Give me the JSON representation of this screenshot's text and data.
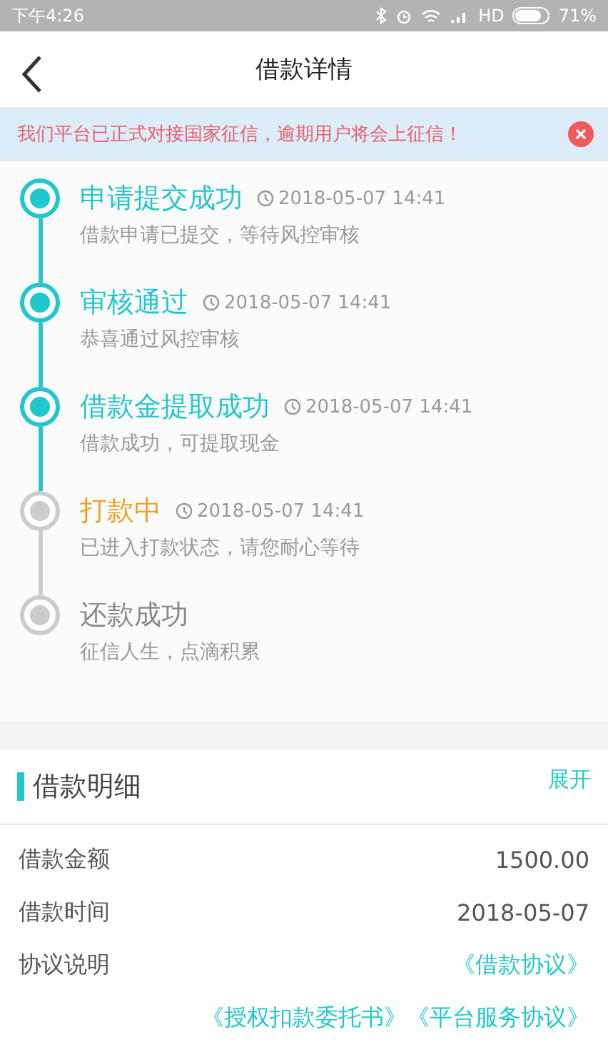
{
  "status_bar": {
    "time": "下午4:26",
    "network": "HD",
    "battery": "71%"
  },
  "header": {
    "title": "借款详情"
  },
  "notice": {
    "text": "我们平台已正式对接国家征信，逾期用户将会上征信！"
  },
  "steps": [
    {
      "title": "申请提交成功",
      "time": "2018-05-07 14:41",
      "desc": "借款申请已提交，等待风控审核",
      "completed": true,
      "active": false
    },
    {
      "title": "审核通过",
      "time": "2018-05-07 14:41",
      "desc": "恭喜通过风控审核",
      "completed": true,
      "active": false
    },
    {
      "title": "借款金提取成功",
      "time": "2018-05-07 14:41",
      "desc": "借款成功，可提取现金",
      "completed": true,
      "active": false
    },
    {
      "title": "打款中",
      "time": "2018-05-07 14:41",
      "desc": "已进入打款状态，请您耐心等待",
      "completed": false,
      "active": true
    },
    {
      "title": "还款成功",
      "desc": "征信人生，点滴积累",
      "completed": false,
      "active": false
    }
  ],
  "details": {
    "title": "借款明细",
    "toggle": "展开",
    "rows": [
      {
        "label": "借款金额",
        "value": "1500.00",
        "kind": "text"
      },
      {
        "label": "借款时间",
        "value": "2018-05-07",
        "kind": "text"
      },
      {
        "label": "协议说明",
        "value": "《借款协议》",
        "kind": "link"
      }
    ],
    "links": [
      "《授权扣款委托书》",
      "《平台服务协议》"
    ]
  }
}
